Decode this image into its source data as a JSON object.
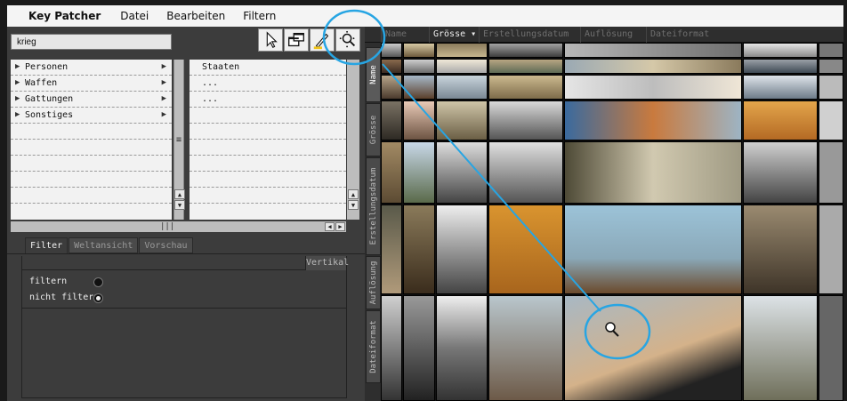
{
  "app": {
    "title": "Key Patcher"
  },
  "menu": [
    "Datei",
    "Bearbeiten",
    "Filtern"
  ],
  "search": {
    "value": "krieg"
  },
  "tools": [
    {
      "name": "pointer-icon"
    },
    {
      "name": "windows-icon"
    },
    {
      "name": "pen-icon"
    },
    {
      "name": "zoom-icon"
    }
  ],
  "categories": [
    "Personen",
    "Waffen",
    "Gattungen",
    "Sonstiges"
  ],
  "subcategories": [
    "Staaten",
    "...",
    "..."
  ],
  "tabs": [
    "Filter",
    "Weltansicht",
    "Vorschau"
  ],
  "panel": {
    "vertikal": "Vertikal",
    "options": [
      "filtern",
      "nicht filtern"
    ],
    "selected": 1
  },
  "sort_tabs": [
    "Name",
    "Grösse",
    "Erstellungsdatum",
    "Auflösung",
    "Dateiformat"
  ],
  "grid_columns": [
    "Name",
    "Grösse ▾",
    "Erstellungsdatum",
    "Auflösung",
    "Dateiformat"
  ],
  "colors": {
    "accent": "#27a5e3",
    "panel": "#3c3c3c",
    "menubar": "#f4f4f4"
  }
}
